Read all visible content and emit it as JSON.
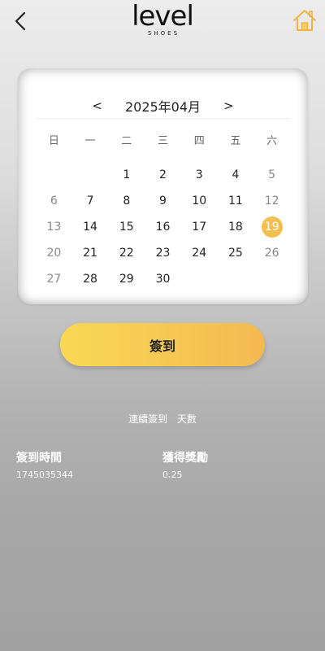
{
  "header": {
    "logo_main": "level",
    "logo_sub": "SHOES"
  },
  "calendar": {
    "prev": "<",
    "next": ">",
    "month_title": "2025年04月",
    "weekdays": [
      "日",
      "一",
      "二",
      "三",
      "四",
      "五",
      "六"
    ],
    "leading_blanks": 2,
    "days": [
      "1",
      "2",
      "3",
      "4",
      "5",
      "6",
      "7",
      "8",
      "9",
      "10",
      "11",
      "12",
      "13",
      "14",
      "15",
      "16",
      "17",
      "18",
      "19",
      "20",
      "21",
      "22",
      "23",
      "24",
      "25",
      "26",
      "27",
      "28",
      "29",
      "30"
    ],
    "today": "19",
    "today_color": "#f3c04f"
  },
  "signin_button": "簽到",
  "streak": {
    "label": "連續簽到",
    "unit": "天數"
  },
  "stats": {
    "signin_time_label": "簽到時間",
    "signin_time_value": "1745035344",
    "reward_label": "獲得獎勵",
    "reward_value": "0.25"
  },
  "colors": {
    "accent": "#f3c04f",
    "button_gradient_start": "#f9d853",
    "button_gradient_end": "#f3b951"
  }
}
